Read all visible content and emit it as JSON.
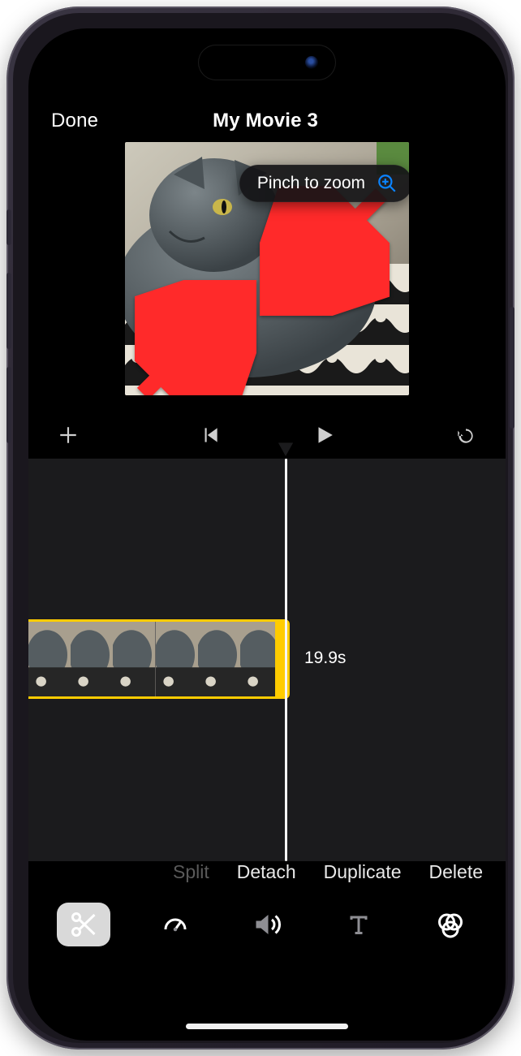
{
  "header": {
    "done_label": "Done",
    "title": "My Movie 3"
  },
  "preview": {
    "tooltip_label": "Pinch to zoom",
    "tooltip_icon": "zoom-in-icon"
  },
  "controls": {
    "add_icon": "plus-icon",
    "restart_icon": "skip-back-icon",
    "play_icon": "play-icon",
    "undo_icon": "undo-icon"
  },
  "timeline": {
    "clip_duration": "19.9s"
  },
  "clip_actions": {
    "split": "Split",
    "detach": "Detach",
    "duplicate": "Duplicate",
    "delete": "Delete"
  },
  "tabs": {
    "clip": "scissors-icon",
    "speed": "speedometer-icon",
    "volume": "speaker-icon",
    "titles": "text-icon",
    "filters": "filters-icon"
  }
}
